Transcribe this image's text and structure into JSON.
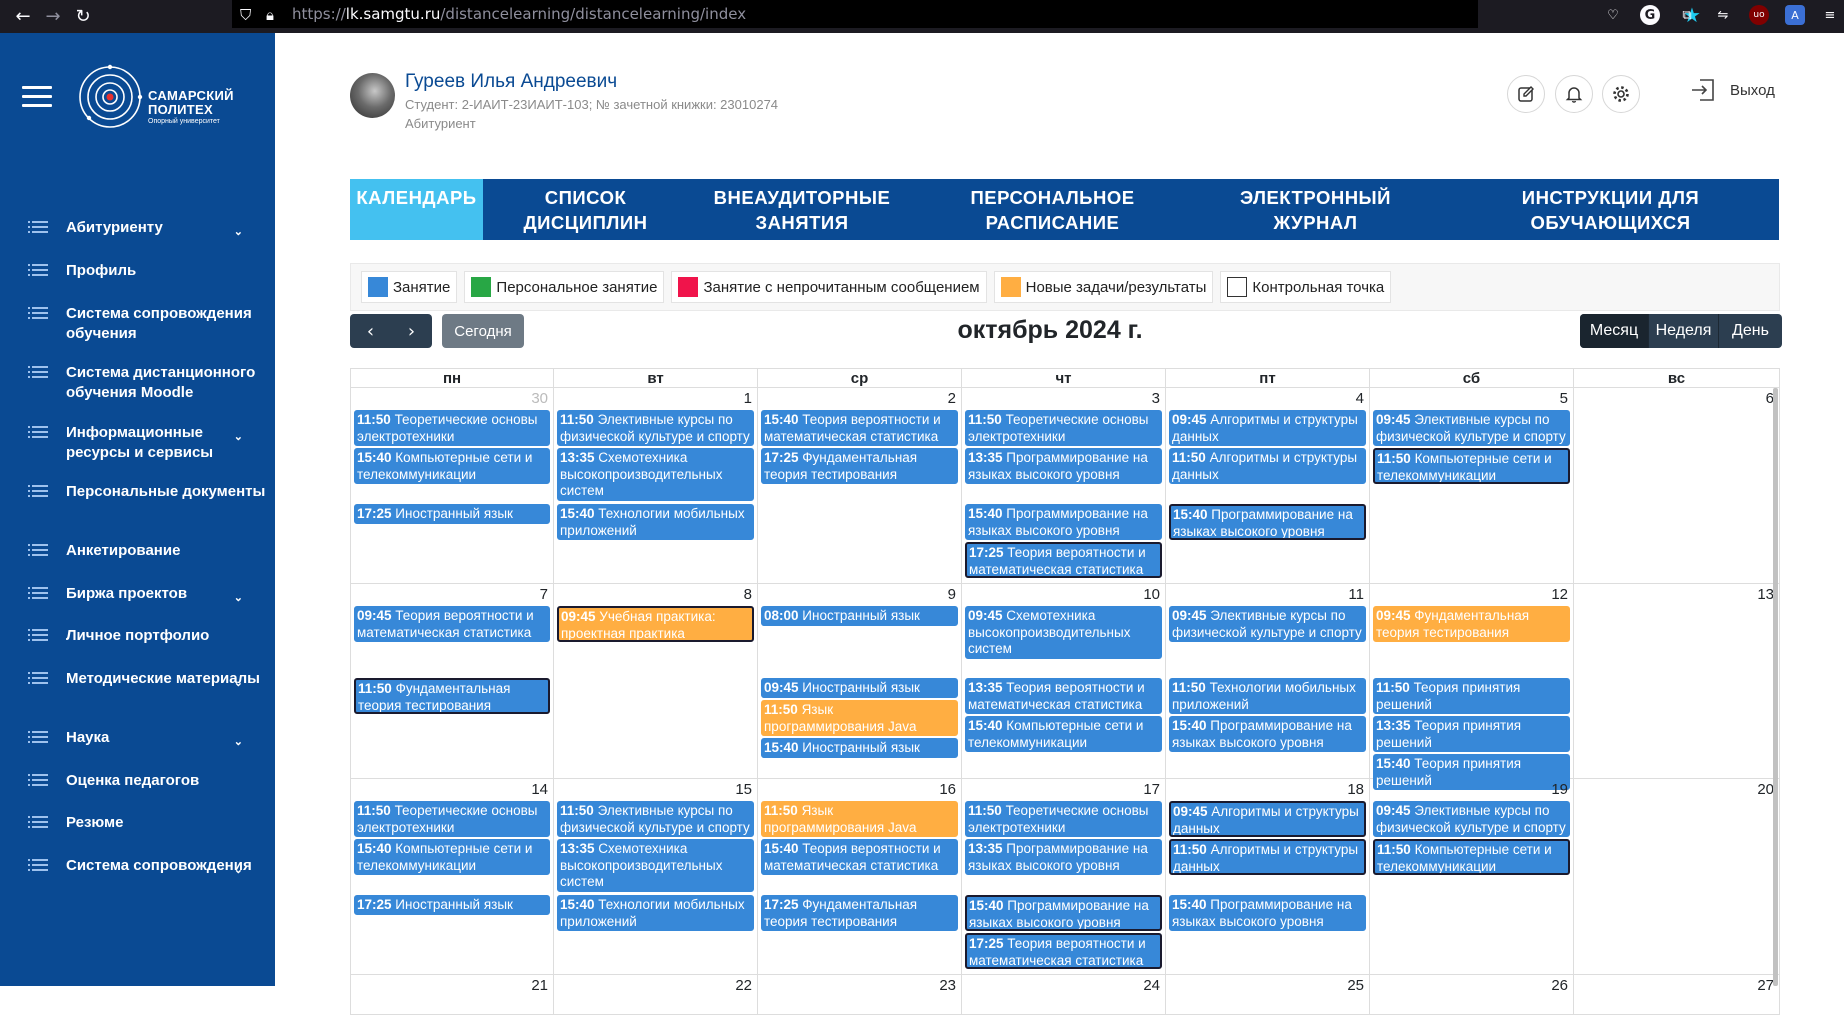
{
  "browser": {
    "url_prefix": "https://",
    "url_host": "lk.samgtu.ru",
    "url_path": "/distancelearning/distancelearning/index"
  },
  "sidebar": {
    "logo_line1": "САМАРСКИЙ",
    "logo_line2": "ПОЛИТЕХ",
    "logo_tagline": "Опорный университет",
    "items": [
      {
        "label": "Абитуриенту",
        "chevron": true
      },
      {
        "label": "Профиль",
        "chevron": false
      },
      {
        "label": "Система сопровождения обучения",
        "chevron": false
      },
      {
        "label": "Система дистанционного обучения Moodle",
        "chevron": false
      },
      {
        "label": "Информационные ресурсы и сервисы",
        "chevron": true
      },
      {
        "label": "Персональные документы",
        "chevron": false
      },
      {
        "label": "Анкетирование",
        "chevron": false
      },
      {
        "label": "Биржа проектов",
        "chevron": true
      },
      {
        "label": "Личное портфолио",
        "chevron": false
      },
      {
        "label": "Методические материалы",
        "chevron": true
      },
      {
        "label": "Наука",
        "chevron": true
      },
      {
        "label": "Оценка педагогов",
        "chevron": false
      },
      {
        "label": "Резюме",
        "chevron": false
      },
      {
        "label": "Система сопровождения",
        "chevron": true
      }
    ]
  },
  "header": {
    "user_name": "Гуреев Илья Андреевич",
    "user_sub": "Студент: 2-ИАИТ-23ИАИТ-103; № зачетной книжки: 23010274",
    "user_role": "Абитуриент",
    "logout_label": "Выход"
  },
  "tabs": [
    {
      "line1": "КАЛЕНДАРЬ",
      "line2": "",
      "active": true
    },
    {
      "line1": "СПИСОК",
      "line2": "ДИСЦИПЛИН",
      "active": false
    },
    {
      "line1": "ВНЕАУДИТОРНЫЕ",
      "line2": "ЗАНЯТИЯ",
      "active": false
    },
    {
      "line1": "ПЕРСОНАЛЬНОЕ",
      "line2": "РАСПИСАНИЕ",
      "active": false
    },
    {
      "line1": "ЭЛЕКТРОННЫЙ",
      "line2": "ЖУРНАЛ",
      "active": false
    },
    {
      "line1": "ИНСТРУКЦИИ ДЛЯ",
      "line2": "ОБУЧАЮЩИХСЯ",
      "active": false
    }
  ],
  "legend": [
    {
      "label": "Занятие",
      "color": "#3788d8"
    },
    {
      "label": "Персональное занятие",
      "color": "#28a745"
    },
    {
      "label": "Занятие с непрочитанным сообщением",
      "color": "#f0144b"
    },
    {
      "label": "Новые задачи/результаты",
      "color": "#ffae42"
    },
    {
      "label": "Контрольная точка",
      "color": "#ffffff"
    }
  ],
  "toolbar": {
    "prev": "‹",
    "next": "›",
    "today": "Сегодня",
    "title": "октябрь 2024 г.",
    "views": [
      {
        "label": "Месяц",
        "active": true
      },
      {
        "label": "Неделя",
        "active": false
      },
      {
        "label": "День",
        "active": false
      }
    ]
  },
  "calendar": {
    "weekdays": [
      "пн",
      "вт",
      "ср",
      "чт",
      "пт",
      "сб",
      "вс"
    ],
    "weeks": [
      [
        {
          "day": "30",
          "other": true,
          "events": [
            {
              "time": "11:50",
              "title": "Теоретические основы электротехники",
              "color": "blue",
              "slot": 0,
              "lines": 2
            },
            {
              "time": "15:40",
              "title": "Компьютерные сети и телекоммуникации",
              "color": "blue",
              "slot": 1,
              "lines": 2
            },
            {
              "time": "17:25",
              "title": "Иностранный язык",
              "color": "blue",
              "slot": 3,
              "lines": 1
            }
          ]
        },
        {
          "day": "1",
          "other": false,
          "events": [
            {
              "time": "11:50",
              "title": "Элективные курсы по физической культуре и спорту",
              "color": "blue",
              "slot": 0,
              "lines": 2
            },
            {
              "time": "13:35",
              "title": "Схемотехника высокопроизводительных систем",
              "color": "blue",
              "slot": 1,
              "lines": 3
            },
            {
              "time": "15:40",
              "title": "Технологии мобильных приложений",
              "color": "blue",
              "slot": 3,
              "lines": 2
            }
          ]
        },
        {
          "day": "2",
          "other": false,
          "events": [
            {
              "time": "15:40",
              "title": "Теория вероятности и математическая статистика",
              "color": "blue",
              "slot": 0,
              "lines": 2
            },
            {
              "time": "17:25",
              "title": "Фундаментальная теория тестирования",
              "color": "blue",
              "slot": 1,
              "lines": 2
            }
          ]
        },
        {
          "day": "3",
          "other": false,
          "events": [
            {
              "time": "11:50",
              "title": "Теоретические основы электротехники",
              "color": "blue",
              "slot": 0,
              "lines": 2
            },
            {
              "time": "13:35",
              "title": "Программирование на языках высокого уровня",
              "color": "blue",
              "slot": 1,
              "lines": 2
            },
            {
              "time": "15:40",
              "title": "Программирование на языках высокого уровня",
              "color": "blue",
              "slot": 3,
              "lines": 2
            },
            {
              "time": "17:25",
              "title": "Теория вероятности и математическая статистика",
              "color": "blue",
              "slot": 4,
              "lines": 2,
              "outlined": true
            }
          ]
        },
        {
          "day": "4",
          "other": false,
          "events": [
            {
              "time": "09:45",
              "title": "Алгоритмы и структуры данных",
              "color": "blue",
              "slot": 0,
              "lines": 2
            },
            {
              "time": "11:50",
              "title": "Алгоритмы и структуры данных",
              "color": "blue",
              "slot": 1,
              "lines": 2
            },
            {
              "time": "15:40",
              "title": "Программирование на языках высокого уровня",
              "color": "blue",
              "slot": 3,
              "lines": 2,
              "outlined": true
            }
          ]
        },
        {
          "day": "5",
          "other": false,
          "events": [
            {
              "time": "09:45",
              "title": "Элективные курсы по физической культуре и спорту",
              "color": "blue",
              "slot": 0,
              "lines": 2
            },
            {
              "time": "11:50",
              "title": "Компьютерные сети и телекоммуникации",
              "color": "blue",
              "slot": 1,
              "lines": 2,
              "outlined": true
            }
          ]
        },
        {
          "day": "6",
          "other": false,
          "events": []
        }
      ],
      [
        {
          "day": "7",
          "other": false,
          "events": [
            {
              "time": "09:45",
              "title": "Теория вероятности и математическая статистика",
              "color": "blue",
              "slot": 0,
              "lines": 2
            },
            {
              "time": "11:50",
              "title": "Фундаментальная теория тестирования",
              "color": "blue",
              "slot": 2,
              "lines": 2,
              "outlined": true
            }
          ]
        },
        {
          "day": "8",
          "other": false,
          "events": [
            {
              "time": "09:45",
              "title": "Учебная практика: проектная практика",
              "color": "orange",
              "slot": 0,
              "lines": 2,
              "outlined": true
            }
          ]
        },
        {
          "day": "9",
          "other": false,
          "events": [
            {
              "time": "08:00",
              "title": "Иностранный язык",
              "color": "blue",
              "slot": 0,
              "lines": 1
            },
            {
              "time": "09:45",
              "title": "Иностранный язык",
              "color": "blue",
              "slot": 2,
              "lines": 1
            },
            {
              "time": "11:50",
              "title": "Язык программирования Java",
              "color": "orange",
              "slot": 3,
              "lines": 2
            },
            {
              "time": "15:40",
              "title": "Иностранный язык",
              "color": "blue",
              "slot": 4,
              "lines": 1
            }
          ]
        },
        {
          "day": "10",
          "other": false,
          "events": [
            {
              "time": "09:45",
              "title": "Схемотехника высокопроизводительных систем",
              "color": "blue",
              "slot": 0,
              "lines": 3
            },
            {
              "time": "13:35",
              "title": "Теория вероятности и математическая статистика",
              "color": "blue",
              "slot": 2,
              "lines": 2
            },
            {
              "time": "15:40",
              "title": "Компьютерные сети и телекоммуникации",
              "color": "blue",
              "slot": 3,
              "lines": 2
            }
          ]
        },
        {
          "day": "11",
          "other": false,
          "events": [
            {
              "time": "09:45",
              "title": "Элективные курсы по физической культуре и спорту",
              "color": "blue",
              "slot": 0,
              "lines": 2
            },
            {
              "time": "11:50",
              "title": "Технологии мобильных приложений",
              "color": "blue",
              "slot": 2,
              "lines": 2
            },
            {
              "time": "15:40",
              "title": "Программирование на языках высокого уровня",
              "color": "blue",
              "slot": 3,
              "lines": 2
            }
          ]
        },
        {
          "day": "12",
          "other": false,
          "events": [
            {
              "time": "09:45",
              "title": "Фундаментальная теория тестирования",
              "color": "orange",
              "slot": 0,
              "lines": 2
            },
            {
              "time": "11:50",
              "title": "Теория принятия решений",
              "color": "blue",
              "slot": 2,
              "lines": 2
            },
            {
              "time": "13:35",
              "title": "Теория принятия решений",
              "color": "blue",
              "slot": 3,
              "lines": 2
            },
            {
              "time": "15:40",
              "title": "Теория принятия решений",
              "color": "blue",
              "slot": 4,
              "lines": 2
            }
          ]
        },
        {
          "day": "13",
          "other": false,
          "events": []
        }
      ],
      [
        {
          "day": "14",
          "other": false,
          "events": [
            {
              "time": "11:50",
              "title": "Теоретические основы электротехники",
              "color": "blue",
              "slot": 0,
              "lines": 2
            },
            {
              "time": "15:40",
              "title": "Компьютерные сети и телекоммуникации",
              "color": "blue",
              "slot": 1,
              "lines": 2
            },
            {
              "time": "17:25",
              "title": "Иностранный язык",
              "color": "blue",
              "slot": 3,
              "lines": 1
            }
          ]
        },
        {
          "day": "15",
          "other": false,
          "events": [
            {
              "time": "11:50",
              "title": "Элективные курсы по физической культуре и спорту",
              "color": "blue",
              "slot": 0,
              "lines": 2
            },
            {
              "time": "13:35",
              "title": "Схемотехника высокопроизводительных систем",
              "color": "blue",
              "slot": 1,
              "lines": 3
            },
            {
              "time": "15:40",
              "title": "Технологии мобильных приложений",
              "color": "blue",
              "slot": 3,
              "lines": 2
            }
          ]
        },
        {
          "day": "16",
          "other": false,
          "events": [
            {
              "time": "11:50",
              "title": "Язык программирования Java",
              "color": "orange",
              "slot": 0,
              "lines": 2
            },
            {
              "time": "15:40",
              "title": "Теория вероятности и математическая статистика",
              "color": "blue",
              "slot": 1,
              "lines": 2
            },
            {
              "time": "17:25",
              "title": "Фундаментальная теория тестирования",
              "color": "blue",
              "slot": 3,
              "lines": 2
            }
          ]
        },
        {
          "day": "17",
          "other": false,
          "events": [
            {
              "time": "11:50",
              "title": "Теоретические основы электротехники",
              "color": "blue",
              "slot": 0,
              "lines": 2
            },
            {
              "time": "13:35",
              "title": "Программирование на языках высокого уровня",
              "color": "blue",
              "slot": 1,
              "lines": 2
            },
            {
              "time": "15:40",
              "title": "Программирование на языках высокого уровня",
              "color": "blue",
              "slot": 3,
              "lines": 2,
              "outlined": true
            },
            {
              "time": "17:25",
              "title": "Теория вероятности и математическая статистика",
              "color": "blue",
              "slot": 4,
              "lines": 2,
              "outlined": true
            }
          ]
        },
        {
          "day": "18",
          "other": false,
          "events": [
            {
              "time": "09:45",
              "title": "Алгоритмы и структуры данных",
              "color": "blue",
              "slot": 0,
              "lines": 2,
              "outlined": true
            },
            {
              "time": "11:50",
              "title": "Алгоритмы и структуры данных",
              "color": "blue",
              "slot": 1,
              "lines": 2,
              "outlined": true
            },
            {
              "time": "15:40",
              "title": "Программирование на языках высокого уровня",
              "color": "blue",
              "slot": 3,
              "lines": 2
            }
          ]
        },
        {
          "day": "19",
          "other": false,
          "events": [
            {
              "time": "09:45",
              "title": "Элективные курсы по физической культуре и спорту",
              "color": "blue",
              "slot": 0,
              "lines": 2
            },
            {
              "time": "11:50",
              "title": "Компьютерные сети и телекоммуникации",
              "color": "blue",
              "slot": 1,
              "lines": 2,
              "outlined": true
            }
          ]
        },
        {
          "day": "20",
          "other": false,
          "events": []
        }
      ],
      [
        {
          "day": "21",
          "other": false,
          "events": []
        },
        {
          "day": "22",
          "other": false,
          "events": []
        },
        {
          "day": "23",
          "other": false,
          "events": []
        },
        {
          "day": "24",
          "other": false,
          "events": []
        },
        {
          "day": "25",
          "other": false,
          "events": []
        },
        {
          "day": "26",
          "other": false,
          "events": []
        },
        {
          "day": "27",
          "other": false,
          "events": []
        }
      ]
    ]
  }
}
